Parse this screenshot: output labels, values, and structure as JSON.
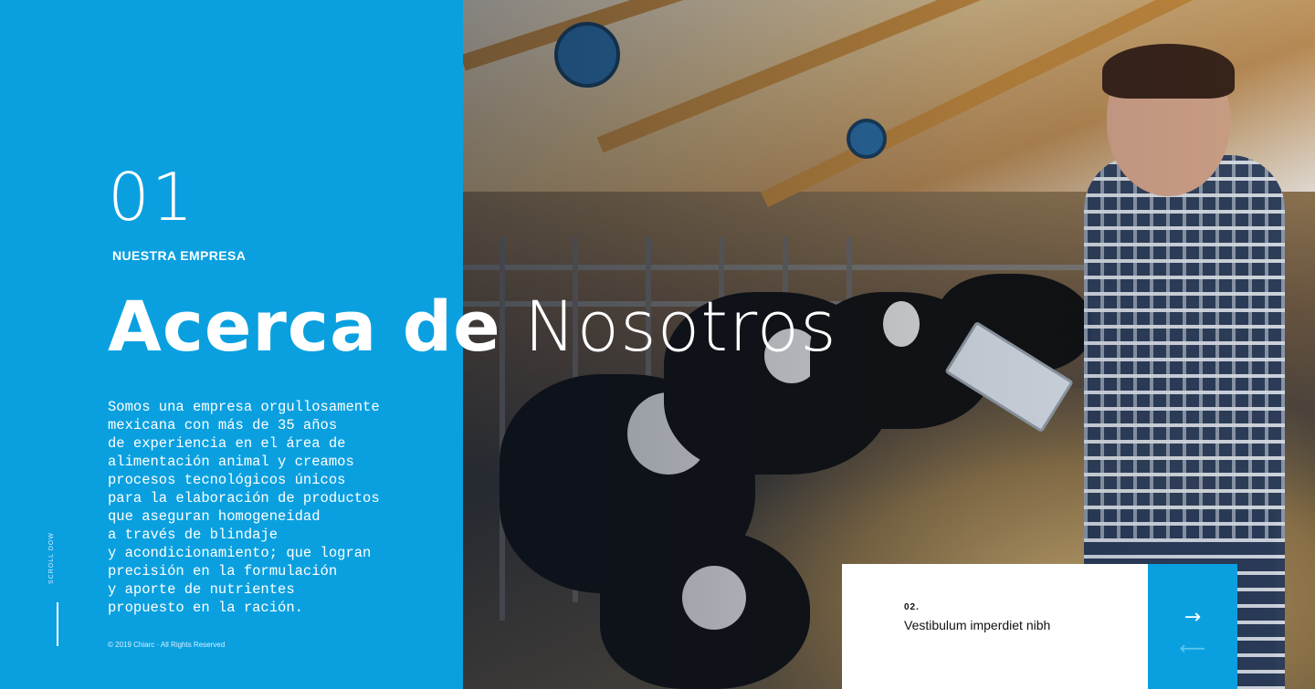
{
  "section": {
    "number": "01",
    "kicker": "NUESTRA EMPRESA",
    "title_part1": "Acerca de",
    "title_part2": "Nosotros",
    "body_lines": [
      "Somos una empresa orgullosamente",
      "mexicana con más de 35 años",
      "de experiencia en el área de",
      "alimentación animal y creamos",
      "procesos tecnológicos únicos",
      "para la elaboración de productos",
      "que aseguran homogeneidad",
      "a través de blindaje",
      "y acondicionamiento; que logran",
      "precisión en la formulación",
      "y aporte de nutrientes",
      "propuesto en la ración."
    ]
  },
  "scroll": {
    "label": "SCROLL DOW"
  },
  "footer": {
    "copyright": "© 2019 Chiarc · All Rights Reserved"
  },
  "next_card": {
    "number": "02.",
    "title": "Vestibulum imperdiet nibh"
  },
  "nav": {
    "next_icon": "arrow-right-icon",
    "prev_icon": "arrow-left-icon",
    "next_glyph": "→",
    "prev_glyph": "⟵"
  },
  "colors": {
    "accent": "#0aa0e0",
    "text": "#ffffff",
    "card_bg": "#ffffff"
  }
}
